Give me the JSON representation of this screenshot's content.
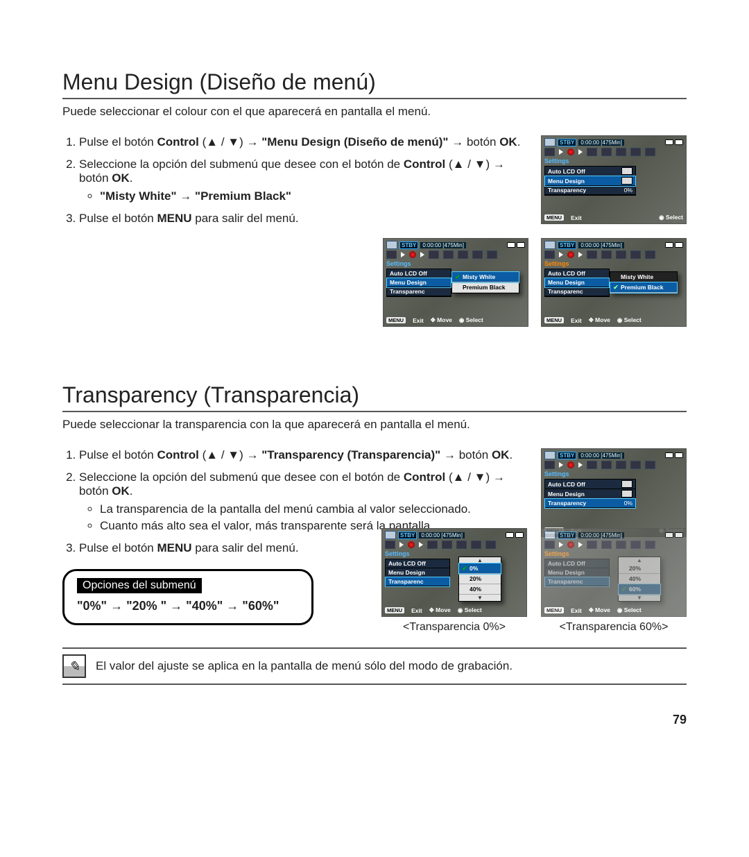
{
  "section1": {
    "heading": "Menu Design (Diseño de menú)",
    "intro": "Puede seleccionar el colour con el que aparecerá en pantalla el menú.",
    "step1_pre": "Pulse el botón ",
    "step1_ctrl": "Control ",
    "step1_arrows": " (▲ / ▼) → ",
    "step1_target": "\"Menu Design (Diseño de menú)\"",
    "step1_post_arrow": " → ",
    "step1_post": "botón ",
    "step1_ok": "OK",
    "step1_dot": ".",
    "step2_pre": "Seleccione la opción del submenú que desee con el botón de ",
    "step2_ctrl": "Control",
    "step2_arrows": " (▲ / ▼) → ",
    "step2_post": "botón ",
    "step2_ok": "OK",
    "step2_dot": ".",
    "step2_opts": "\"Misty White\" → \"Premium Black\"",
    "step3_pre": "Pulse el botón ",
    "step3_menu": "MENU",
    "step3_post": " para salir del menú."
  },
  "section2": {
    "heading": "Transparency (Transparencia)",
    "intro": "Puede seleccionar la transparencia con la que aparecerá en pantalla el menú.",
    "step1_pre": "Pulse el botón ",
    "step1_ctrl": "Control",
    "step1_arrows": " (▲ / ▼) → ",
    "step1_target": "\"Transparency (Transparencia)\"",
    "step1_post_arrow": " → ",
    "step1_post": "botón ",
    "step1_ok": "OK",
    "step1_dot": ".",
    "step2_pre": "Seleccione la opción del submenú que desee con el botón de ",
    "step2_ctrl": "Control",
    "step2_arrows": " (▲ / ▼) → ",
    "step2_post": "botón ",
    "step2_ok": "OK",
    "step2_dot": ".",
    "step2_b1": "La transparencia de la pantalla del menú cambia al valor seleccionado.",
    "step2_b2": "Cuanto más alto sea el valor, más transparente será la pantalla.",
    "step3_pre": "Pulse el botón ",
    "step3_menu": "MENU",
    "step3_post": " para salir del menú.",
    "subbox_label": "Opciones del submenú",
    "subbox_opts": "\"0%\" → \"20% \" → \"40%\" → \"60%\"",
    "caption_left": "<Transparencia 0%>",
    "caption_right": "<Transparencia 60%>"
  },
  "thumb": {
    "stby": "STBY",
    "time": "0:00:00 [475Min]",
    "settings": "Settings",
    "auto_lcd": "Auto LCD Off",
    "menu_design": "Menu Design",
    "transparency": "Transparency",
    "transparenc": "Transparenc",
    "val_0": "0%",
    "misty": "Misty White",
    "premium": "Premium Black",
    "p20": "20%",
    "p40": "40%",
    "p60": "60%",
    "exit": "Exit",
    "move": "Move",
    "select": "Select",
    "menu_pill": "MENU"
  },
  "note": "El valor del ajuste se aplica en la pantalla de menú sólo del modo de grabación.",
  "pagenum": "79"
}
